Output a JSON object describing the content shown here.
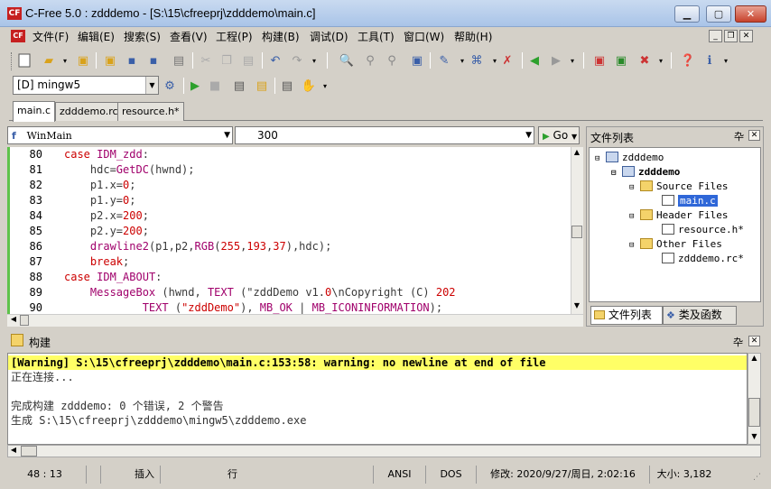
{
  "window": {
    "title": "C-Free 5.0 : zdddemo - [S:\\15\\cfreeprj\\zdddemo\\main.c]",
    "app_icon": "CF"
  },
  "menu": [
    "文件(F)",
    "编辑(E)",
    "搜索(S)",
    "查看(V)",
    "工程(P)",
    "构建(B)",
    "调试(D)",
    "工具(T)",
    "窗口(W)",
    "帮助(H)"
  ],
  "toolbar": {
    "compiler": "[D] mingw5"
  },
  "tabs": [
    "main.c",
    "zdddemo.rc*",
    "resource.h*"
  ],
  "editor_header": {
    "function_combo": "WinMain",
    "line_combo": "300",
    "go_label": "Go"
  },
  "code": [
    {
      "n": "80",
      "t": "case IDM_zdd:"
    },
    {
      "n": "81",
      "t": "    hdc=GetDC(hwnd);"
    },
    {
      "n": "82",
      "t": "    p1.x=0;"
    },
    {
      "n": "83",
      "t": "    p1.y=0;"
    },
    {
      "n": "84",
      "t": "    p2.x=200;"
    },
    {
      "n": "85",
      "t": "    p2.y=200;"
    },
    {
      "n": "86",
      "t": "    drawline2(p1,p2,RGB(255,193,37),hdc);"
    },
    {
      "n": "87",
      "t": "    break;"
    },
    {
      "n": "88",
      "t": "case IDM_ABOUT:"
    },
    {
      "n": "89",
      "t": "    MessageBox (hwnd, TEXT (\"zddDemo v1.0\\nCopyright (C) 202"
    },
    {
      "n": "90",
      "t": "            TEXT (\"zddDemo\"), MB_OK | MB_ICONINFORMATION);"
    }
  ],
  "file_panel": {
    "title": "文件列表",
    "tree": {
      "root": "zdddemo",
      "project": "zdddemo",
      "source_folder": "Source Files",
      "source_file": "main.c",
      "header_folder": "Header Files",
      "header_file": "resource.h*",
      "other_folder": "Other Files",
      "other_file": "zdddemo.rc*"
    },
    "tabs": [
      "文件列表",
      "类及函数"
    ]
  },
  "build": {
    "title": "构建",
    "lines": [
      "[Warning] S:\\15\\cfreeprj\\zdddemo\\main.c:153:58: warning: no newline at end of file",
      "正在连接...",
      "",
      "完成构建 zdddemo: 0 个错误, 2 个警告",
      "生成 S:\\15\\cfreeprj\\zdddemo\\mingw5\\zdddemo.exe"
    ]
  },
  "status": {
    "position": "48 : 13",
    "insert": "插入",
    "mode": "行",
    "encoding": "ANSI",
    "eol": "DOS",
    "modified": "修改: 2020/9/27/周日, 2:02:16",
    "size": "大小: 3,182"
  }
}
